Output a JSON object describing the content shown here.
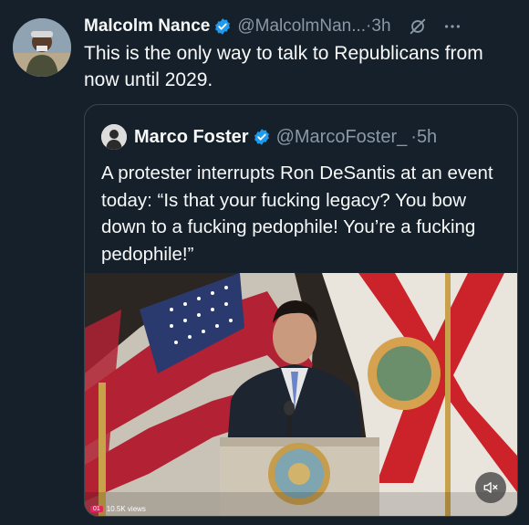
{
  "tweet": {
    "author_name": "Malcolm Nance",
    "author_handle": "@MalcolmNan...",
    "separator": "·",
    "time": "3h",
    "text": "This is the only way to talk to Republicans from now until 2029."
  },
  "quote": {
    "author_name": "Marco Foster",
    "author_handle": "@MarcoFoster_",
    "separator": "·",
    "time": "5h",
    "text": "A protester interrupts Ron DeSantis at an event today: “Is that your fucking legacy? You bow down to a fucking pedophile! You’re a fucking pedophile!”"
  },
  "media": {
    "views": "10.5K views",
    "live_badge": "01",
    "mute_icon": "volume-muted-icon"
  },
  "colors": {
    "background": "#15202b",
    "text": "#f7f9f9",
    "secondary": "#8b98a5",
    "verified": "#1d9bf0",
    "border": "#38444d"
  }
}
